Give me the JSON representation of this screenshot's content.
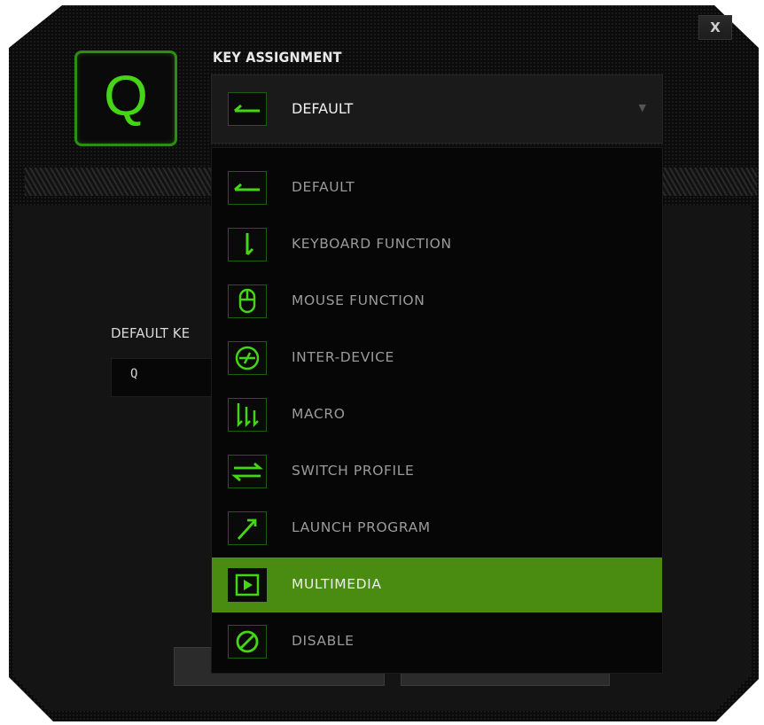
{
  "window": {
    "close_label": "X"
  },
  "key": {
    "letter": "Q"
  },
  "key_assignment": {
    "title": "KEY ASSIGNMENT",
    "selected": "DEFAULT",
    "selected_icon": "arrow-left-icon"
  },
  "options": [
    {
      "label": "DEFAULT",
      "icon": "arrow-left-icon"
    },
    {
      "label": "KEYBOARD FUNCTION",
      "icon": "keyboard-down-arrow-icon"
    },
    {
      "label": "MOUSE FUNCTION",
      "icon": "mouse-icon"
    },
    {
      "label": "INTER-DEVICE",
      "icon": "inter-device-icon"
    },
    {
      "label": "MACRO",
      "icon": "macro-icon"
    },
    {
      "label": "SWITCH PROFILE",
      "icon": "switch-profile-icon"
    },
    {
      "label": "LAUNCH PROGRAM",
      "icon": "launch-arrow-icon"
    },
    {
      "label": "MULTIMEDIA",
      "icon": "play-icon"
    },
    {
      "label": "DISABLE",
      "icon": "disable-icon"
    }
  ],
  "highlighted_option": "MULTIMEDIA",
  "default_key": {
    "label": "DEFAULT KE",
    "value": "Q"
  },
  "colors": {
    "accent": "#44d614",
    "highlight": "#4a8c12",
    "background": "#0b0b0b"
  }
}
